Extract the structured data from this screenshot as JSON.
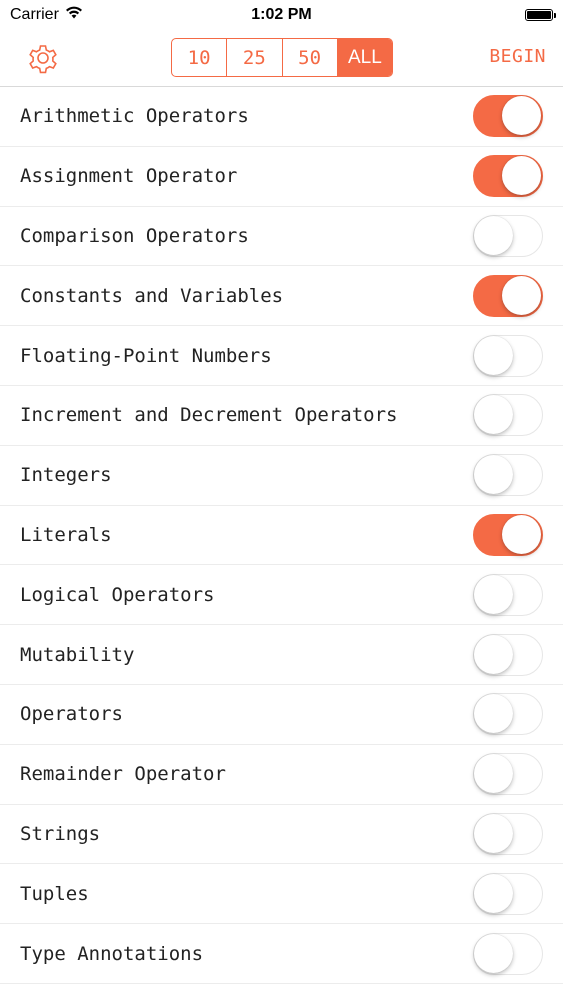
{
  "status_bar": {
    "carrier": "Carrier",
    "time": "1:02 PM",
    "icons": [
      "wifi-icon",
      "battery-icon"
    ]
  },
  "nav": {
    "settings_icon": "gear-icon",
    "segments": [
      "10",
      "25",
      "50",
      "ALL"
    ],
    "selected_segment": "ALL",
    "begin_label": "BEGIN"
  },
  "colors": {
    "accent": "#f46a45"
  },
  "topics": [
    {
      "label": "Arithmetic Operators",
      "enabled": true
    },
    {
      "label": "Assignment Operator",
      "enabled": true
    },
    {
      "label": "Comparison Operators",
      "enabled": false
    },
    {
      "label": "Constants and Variables",
      "enabled": true
    },
    {
      "label": "Floating-Point Numbers",
      "enabled": false
    },
    {
      "label": "Increment and Decrement Operators",
      "enabled": false
    },
    {
      "label": "Integers",
      "enabled": false
    },
    {
      "label": "Literals",
      "enabled": true
    },
    {
      "label": "Logical Operators",
      "enabled": false
    },
    {
      "label": "Mutability",
      "enabled": false
    },
    {
      "label": "Operators",
      "enabled": false
    },
    {
      "label": "Remainder Operator",
      "enabled": false
    },
    {
      "label": "Strings",
      "enabled": false
    },
    {
      "label": "Tuples",
      "enabled": false
    },
    {
      "label": "Type Annotations",
      "enabled": false
    }
  ]
}
